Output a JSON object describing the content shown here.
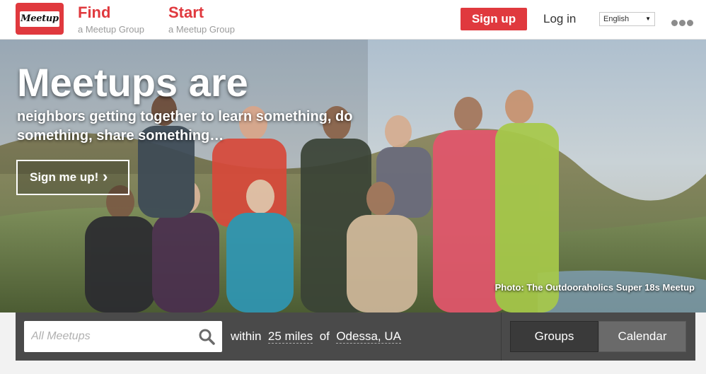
{
  "header": {
    "logo_text": "Meetup",
    "find": {
      "title": "Find",
      "subtitle": "a Meetup Group"
    },
    "start": {
      "title": "Start",
      "subtitle": "a Meetup Group"
    },
    "signup_label": "Sign up",
    "login_label": "Log in",
    "language": {
      "selected": "English"
    },
    "more_icon": "more-dots-icon"
  },
  "hero": {
    "headline": "Meetups are",
    "subheadline": "neighbors getting together to learn something, do something, share something…",
    "cta_label": "Sign me up!",
    "photo_credit": "Photo: The Outdooraholics Super 18s Meetup"
  },
  "search": {
    "placeholder": "All Meetups",
    "within_label": "within",
    "distance": "25 miles",
    "of_label": "of",
    "location": "Odessa, UA"
  },
  "view_tabs": {
    "groups_label": "Groups",
    "calendar_label": "Calendar"
  },
  "colors": {
    "brand_red": "#e0393e",
    "search_bar_bg": "#4a4a4a",
    "active_tab_bg": "#3a3a3a",
    "inactive_tab_bg": "#6a6a6a"
  }
}
